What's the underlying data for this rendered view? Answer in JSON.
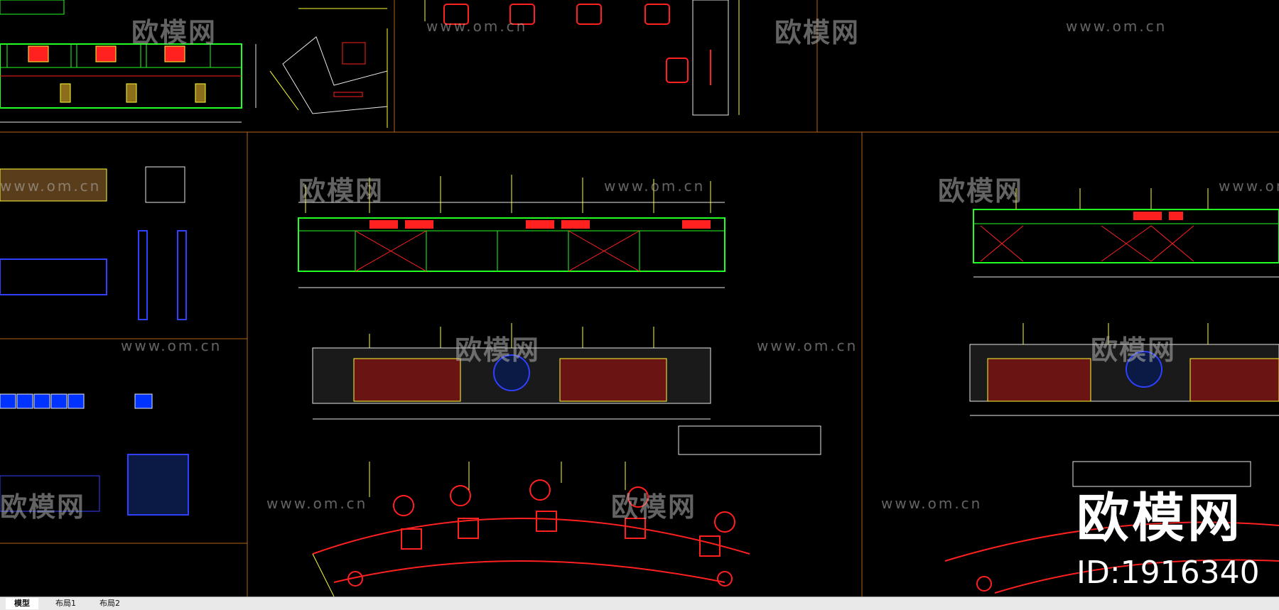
{
  "watermark": {
    "logo_text": "欧模网",
    "url_text": "www.om.cn",
    "big_logo": "欧模网",
    "id_text": "ID:1916340"
  },
  "tabs": [
    {
      "label": "模型",
      "active": true
    },
    {
      "label": "布局1",
      "active": false
    },
    {
      "label": "布局2",
      "active": false
    }
  ],
  "colors": {
    "background": "#000000",
    "frame": "#b5651d",
    "green": "#22ff22",
    "red": "#ff2020",
    "yellow": "#ffff33",
    "blue": "#3040ff",
    "white": "#e8e8e8"
  }
}
